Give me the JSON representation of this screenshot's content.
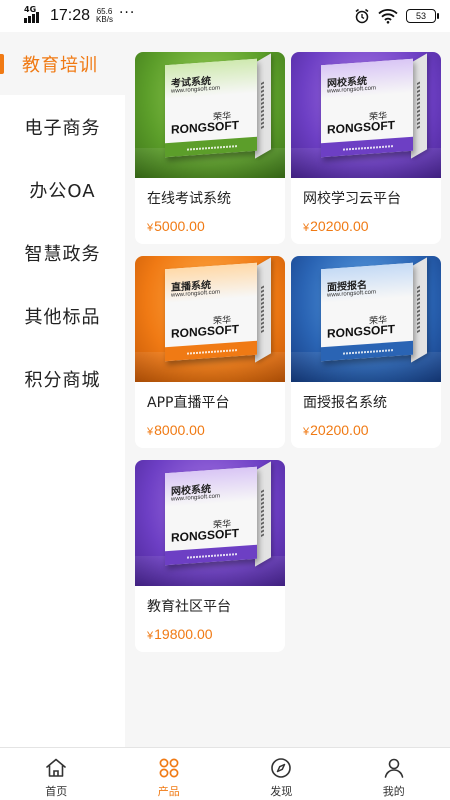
{
  "status_bar": {
    "network": "4G",
    "time": "17:28",
    "speed_value": "65.6",
    "speed_unit": "KB/s",
    "dots": "···",
    "battery": "53"
  },
  "sidebar": {
    "items": [
      {
        "label": "教育培训",
        "active": true
      },
      {
        "label": "电子商务",
        "active": false
      },
      {
        "label": "办公OA",
        "active": false
      },
      {
        "label": "智慧政务",
        "active": false
      },
      {
        "label": "其他标品",
        "active": false
      },
      {
        "label": "积分商城",
        "active": false
      }
    ]
  },
  "products": [
    {
      "name": "在线考试系统",
      "currency": "¥",
      "price": "5000.00",
      "box_title": "考试系统",
      "box_url": "www.rongsoft.com",
      "brand": "RONGSOFT",
      "brand_cn": "荣华",
      "color": "green"
    },
    {
      "name": "网校学习云平台",
      "currency": "¥",
      "price": "20200.00",
      "box_title": "网校系统",
      "box_url": "www.rongsoft.com",
      "brand": "RONGSOFT",
      "brand_cn": "荣华",
      "color": "purple"
    },
    {
      "name": "APP直播平台",
      "currency": "¥",
      "price": "8000.00",
      "box_title": "直播系统",
      "box_url": "www.rongsoft.com",
      "brand": "RONGSOFT",
      "brand_cn": "荣华",
      "color": "orange"
    },
    {
      "name": "面授报名系统",
      "currency": "¥",
      "price": "20200.00",
      "box_title": "面授报名",
      "box_url": "www.rongsoft.com",
      "brand": "RONGSOFT",
      "brand_cn": "荣华",
      "color": "blue"
    },
    {
      "name": "教育社区平台",
      "currency": "¥",
      "price": "19800.00",
      "box_title": "网校系统",
      "box_url": "www.rongsoft.com",
      "brand": "RONGSOFT",
      "brand_cn": "荣华",
      "color": "purple"
    }
  ],
  "bottom_nav": {
    "items": [
      {
        "label": "首页",
        "icon": "home-icon",
        "active": false
      },
      {
        "label": "产品",
        "icon": "products-grid-icon",
        "active": true
      },
      {
        "label": "发现",
        "icon": "compass-icon",
        "active": false
      },
      {
        "label": "我的",
        "icon": "user-icon",
        "active": false
      }
    ]
  },
  "colors": {
    "accent": "#f07a14",
    "background": "#f6f6f6",
    "text": "#222222"
  }
}
